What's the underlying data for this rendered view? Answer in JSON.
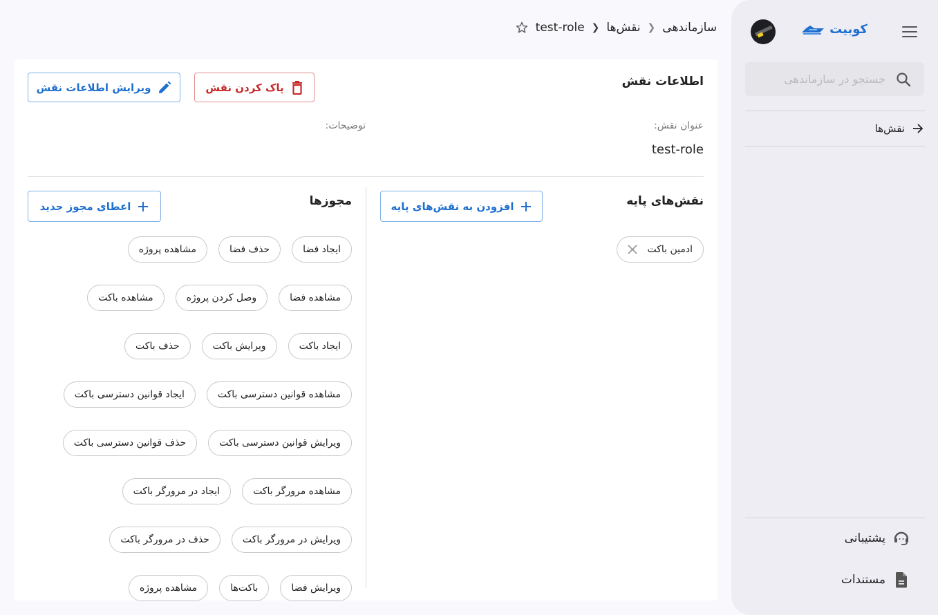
{
  "sidebar": {
    "brand": "کوبیت",
    "search_placeholder": "جستجو در سازماندهی",
    "nav_items": [
      {
        "label": "نقش‌ها",
        "icon": "arrow-right-icon"
      }
    ],
    "bottom_items": [
      {
        "label": "پشتیبانی",
        "icon": "support-headset-icon"
      },
      {
        "label": "مستندات",
        "icon": "document-icon"
      }
    ]
  },
  "breadcrumb": {
    "items": [
      "سازماندهی",
      "نقش‌ها",
      "test-role"
    ],
    "favorite_icon": "star-outline-icon"
  },
  "role_info": {
    "title": "اطلاعات نقش",
    "delete_button": "پاک کردن نقش",
    "edit_button": "ویرایش اطلاعات نقش",
    "name_label": "عنوان نقش:",
    "name_value": "test-role",
    "description_label": "توضیحات:"
  },
  "base_roles": {
    "title": "نقش‌های پایه",
    "add_button": "افزودن به نقش‌های پایه",
    "items": [
      "ادمین باکت"
    ]
  },
  "permissions": {
    "title": "مجوزها",
    "add_button": "اعطای مجوز جدید",
    "rows": [
      [
        "ایجاد فضا",
        "حذف فضا",
        "مشاهده پروژه"
      ],
      [
        "مشاهده فضا",
        "وصل کردن پروژه",
        "مشاهده باکت"
      ],
      [
        "ایجاد باکت",
        "ویرایش باکت",
        "حذف باکت"
      ],
      [
        "مشاهده قوانین دسترسی باکت",
        "ایجاد قوانین دسترسی باکت"
      ],
      [
        "ویرایش قوانین دسترسی باکت",
        "حذف قوانین دسترسی باکت"
      ],
      [
        "مشاهده مرورگر باکت",
        "ایجاد در مرورگر باکت"
      ],
      [
        "ویرایش در مرورگر باکت",
        "حذف در مرورگر باکت"
      ],
      [
        "ویرایش فضا",
        "باکت‌ها",
        "مشاهده پروژه"
      ]
    ]
  },
  "colors": {
    "accent": "#1f6fd0",
    "danger": "#c62828",
    "sidebar_bg": "#ededf3",
    "page_bg": "#f9f9fd"
  }
}
